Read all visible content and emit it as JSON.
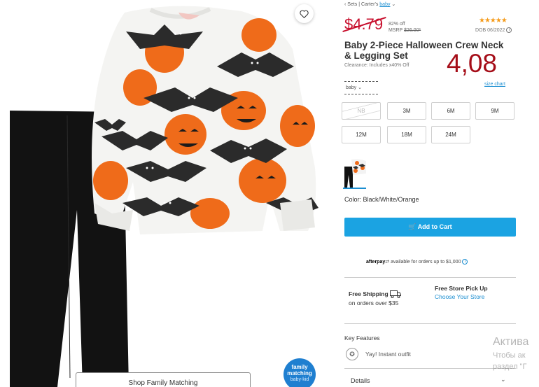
{
  "breadcrumb": {
    "item1": "‹ Sets",
    "sep": "|",
    "item2": "Carter's",
    "item3": "baby",
    "chevron": "⌄"
  },
  "price": {
    "original": "$4.79",
    "percent_off": "82% off",
    "msrp_label": "MSRP",
    "msrp_value": "$26.00*"
  },
  "rating": {
    "stars": "★★★★★",
    "dob": "DOB 06/2022"
  },
  "product": {
    "title": "Baby 2-Piece Halloween Crew Neck & Legging Set",
    "clearance_note": "Clearance: Includes x40% Off",
    "overlay_price": "4,08"
  },
  "size_selector": {
    "value": "baby",
    "chevron": "⌄",
    "size_chart_link": "size chart"
  },
  "sizes": [
    {
      "label": "NB",
      "available": false
    },
    {
      "label": "3M",
      "available": true
    },
    {
      "label": "6M",
      "available": true
    },
    {
      "label": "9M",
      "available": true
    },
    {
      "label": "12M",
      "available": true
    },
    {
      "label": "18M",
      "available": true
    },
    {
      "label": "24M",
      "available": true
    }
  ],
  "color": {
    "label": "Color: Black/White/Orange"
  },
  "cart": {
    "button_label": "Add to Cart",
    "icon": "cart-icon"
  },
  "afterpay": {
    "logo": "afterpay",
    "text": "available for orders up to $1,000"
  },
  "shipping": {
    "title": "Free Shipping",
    "subtitle": "on orders over $35",
    "icon": "truck-icon"
  },
  "pickup": {
    "title": "Free Store Pick Up",
    "link": "Choose Your Store"
  },
  "key_features": {
    "title": "Key Features",
    "items": [
      "Yay! Instant outfit"
    ]
  },
  "details": {
    "label": "Details",
    "chevron": "⌄"
  },
  "image_overlay": {
    "shop_family_button": "Shop Family Matching",
    "badge_line1": "family",
    "badge_line2": "matching",
    "badge_line3": "baby-kid"
  },
  "watermark": {
    "line1": "Актива",
    "line2": "Чтобы ак",
    "line3": "раздел \"Г"
  },
  "colors": {
    "accent_blue": "#1ba3e2",
    "price_red": "#c8102e",
    "overlay_red": "#a50d18",
    "star_orange": "#f59b1a",
    "link_blue": "#1b8ed1"
  }
}
